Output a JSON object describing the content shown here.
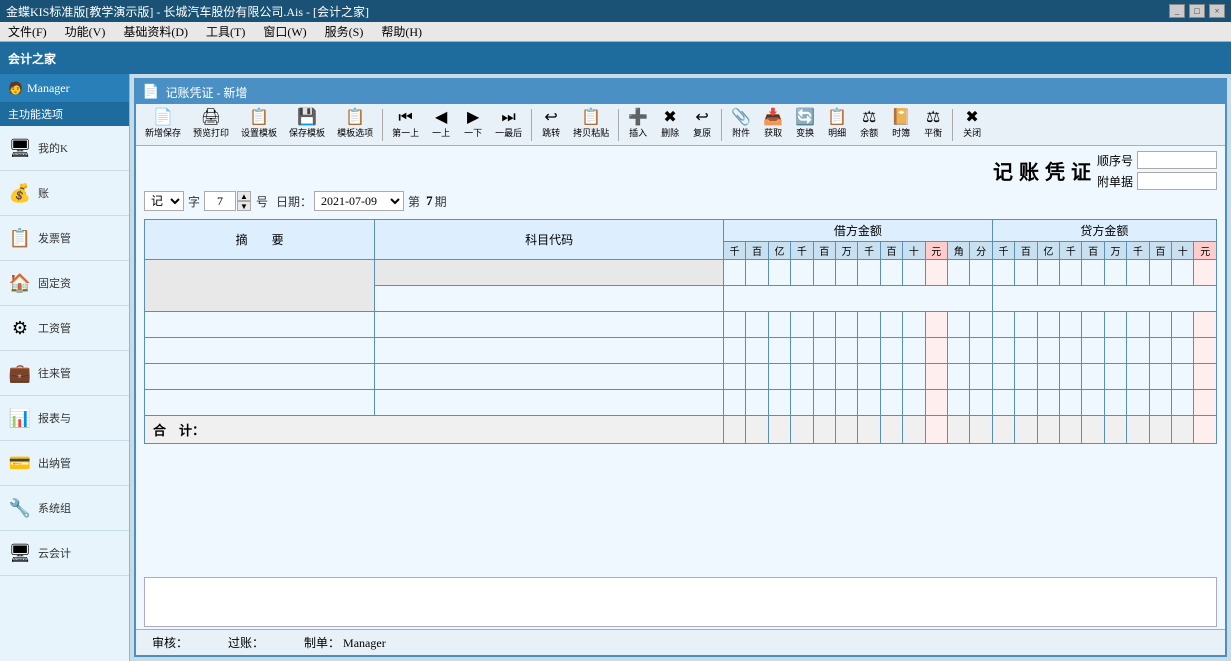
{
  "titleBar": {
    "text": "金蝶KIS标准版[教学演示版] - 长城汽车股份有限公司.Ais - [会计之家]",
    "buttons": [
      "_",
      "□",
      "×"
    ]
  },
  "menuBar": {
    "items": [
      "文件(F)",
      "功能(V)",
      "基础资料(D)",
      "工具(T)",
      "窗口(W)",
      "服务(S)",
      "帮助(H)"
    ]
  },
  "appHeader": {
    "title": "会计之家"
  },
  "sidebar": {
    "managerLabel": "Manager",
    "navTitle": "主功能选项",
    "items": [
      {
        "id": "my-k",
        "label": "我的K",
        "icon": "🖥"
      },
      {
        "id": "account",
        "label": "账",
        "icon": "💰"
      },
      {
        "id": "invoice",
        "label": "发票管",
        "icon": "📋"
      },
      {
        "id": "fixed-asset",
        "label": "固定资",
        "icon": "🏠"
      },
      {
        "id": "payroll",
        "label": "工资管",
        "icon": "⚙"
      },
      {
        "id": "contact",
        "label": "往来管",
        "icon": "💼"
      },
      {
        "id": "report",
        "label": "报表与",
        "icon": "📊"
      },
      {
        "id": "cashier",
        "label": "出纳管",
        "icon": "💳"
      },
      {
        "id": "system",
        "label": "系统组",
        "icon": "🔧"
      },
      {
        "id": "cloud",
        "label": "云会计",
        "icon": "🖥"
      }
    ]
  },
  "docWindow": {
    "title": "记账凭证 - 新增",
    "icon": "📄"
  },
  "toolbar": {
    "buttons": [
      {
        "id": "new-save",
        "icon": "📄",
        "label": "新增保存"
      },
      {
        "id": "preview-print",
        "icon": "🖨",
        "label": "预览打印"
      },
      {
        "id": "set-template",
        "icon": "⚙",
        "label": "设置模板"
      },
      {
        "id": "save-template",
        "icon": "💾",
        "label": "保存模板"
      },
      {
        "id": "select-template",
        "icon": "📋",
        "label": "模板选项"
      },
      {
        "id": "first",
        "icon": "⏮",
        "label": "第一上"
      },
      {
        "id": "prev",
        "icon": "◀",
        "label": "一"
      },
      {
        "id": "next",
        "icon": "▶",
        "label": "一下"
      },
      {
        "id": "last",
        "icon": "⏭",
        "label": "一最后"
      },
      {
        "id": "jump",
        "icon": "↩",
        "label": "跳转"
      },
      {
        "id": "copy-paste",
        "icon": "📋",
        "label": "拷贝粘贴"
      },
      {
        "id": "insert",
        "icon": "➕",
        "label": "插入"
      },
      {
        "id": "delete",
        "icon": "✖",
        "label": "删除"
      },
      {
        "id": "restore",
        "icon": "↩",
        "label": "复原"
      },
      {
        "id": "attachment",
        "icon": "📎",
        "label": "附件"
      },
      {
        "id": "get",
        "icon": "📥",
        "label": "获取"
      },
      {
        "id": "change",
        "icon": "🔄",
        "label": "变换"
      },
      {
        "id": "detail",
        "icon": "📋",
        "label": "明细"
      },
      {
        "id": "balance",
        "icon": "⚖",
        "label": "余额"
      },
      {
        "id": "time-book",
        "icon": "📔",
        "label": "时簿"
      },
      {
        "id": "balance2",
        "icon": "⚖",
        "label": "平衡"
      },
      {
        "id": "close",
        "icon": "✖",
        "label": "关闭"
      }
    ]
  },
  "form": {
    "title": "记账凭证",
    "typeLabel": "记",
    "typeValue": "记",
    "ziLabel": "字",
    "numLabel": "7",
    "haoLabel": "号",
    "dateLabel": "日期：",
    "dateValue": "2021-07-09",
    "periodLabel": "第",
    "periodValue": "7",
    "periodUnit": "期",
    "seqLabel": "顺序号",
    "attachLabel": "附单据"
  },
  "table": {
    "headers": {
      "summary": "摘　　要",
      "code": "科目代码",
      "debit": "借方金额",
      "credit": "贷方金额"
    },
    "moneyHeaders": [
      "千",
      "百",
      "亿",
      "千",
      "百",
      "万",
      "千",
      "百",
      "十",
      "元",
      "角",
      "分",
      "千",
      "百",
      "亿",
      "千",
      "百",
      "万",
      "千",
      "百",
      "十",
      "元"
    ],
    "dataRows": 7,
    "totalLabel": "合　计："
  },
  "footer": {
    "auditLabel": "审核：",
    "postLabel": "过账：",
    "makerLabel": "制单：",
    "makerValue": "Manager"
  }
}
